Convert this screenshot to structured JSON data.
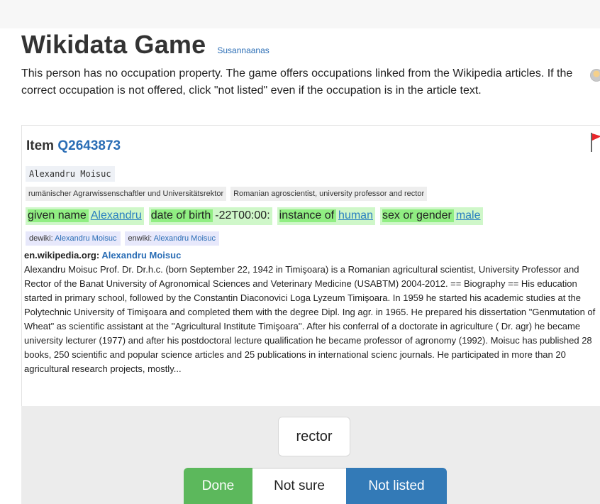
{
  "header": {
    "title": "Wikidata Game",
    "user": "Susannaanas"
  },
  "intro": "This person has no occupation property. The game offers occupations linked from the Wikipedia articles. If the correct occupation is not offered, click \"not listed\" even if the occupation is in the article text.",
  "item": {
    "heading_prefix": "Item",
    "qid": "Q2643873",
    "label": "Alexandru Moisuc",
    "descriptions": [
      "rumänischer Agrarwissenschaftler und Universitätsrektor",
      "Romanian agroscientist, university professor and rector"
    ],
    "claims": [
      {
        "property": "given name",
        "value": "Alexandru",
        "linked": true
      },
      {
        "property": "date of birth",
        "value": "-22T00:00:",
        "linked": false
      },
      {
        "property": "instance of",
        "value": "human",
        "linked": true
      },
      {
        "property": "sex or gender",
        "value": "male",
        "linked": true
      }
    ],
    "sitelinks": [
      {
        "wiki": "dewiki:",
        "title": "Alexandru Moisuc"
      },
      {
        "wiki": "enwiki:",
        "title": "Alexandru Moisuc"
      }
    ]
  },
  "wikipedia": {
    "source": "en.wikipedia.org:",
    "article": "Alexandru Moisuc",
    "text": "Alexandru Moisuc Prof. Dr. Dr.h.c. (born September 22, 1942 in Timişoara) is a Romanian agricultural scientist, University Professor and Rector of the Banat University of Agronomical Sciences and Veterinary Medicine (USABTM) 2004-2012. == Biography == His education started in primary school, followed by the Constantin Diaconovici Loga Lyzeum Timişoara. In 1959 he started his academic studies at the Polytechnic University of Timişoara and completed them with the degree Dipl. Ing agr. in 1965. He prepared his dissertation \"Genmutation of Wheat\" as scientific assistant at the ''Agricultural Institute Timişoara''. After his conferral of a doctorate in agriculture ( Dr. agr) he became university lecturer (1977) and after his postdoctoral lecture qualification he became professor of agronomy (1992). Moisuc has published 28 books, 250 scientific and popular science articles and 25 publications in international scienc journals. He participated in more than 20 agricultural research projects, mostly..."
  },
  "choices": {
    "occupation": "rector"
  },
  "actions": {
    "done": "Done",
    "not_sure": "Not sure",
    "not_listed": "Not listed"
  },
  "colors": {
    "link": "#2a6db5",
    "claim_bg": "#cff7c9",
    "claim_prop_bg": "#90ee82",
    "done": "#5cb85c",
    "not_listed": "#337ab7"
  }
}
